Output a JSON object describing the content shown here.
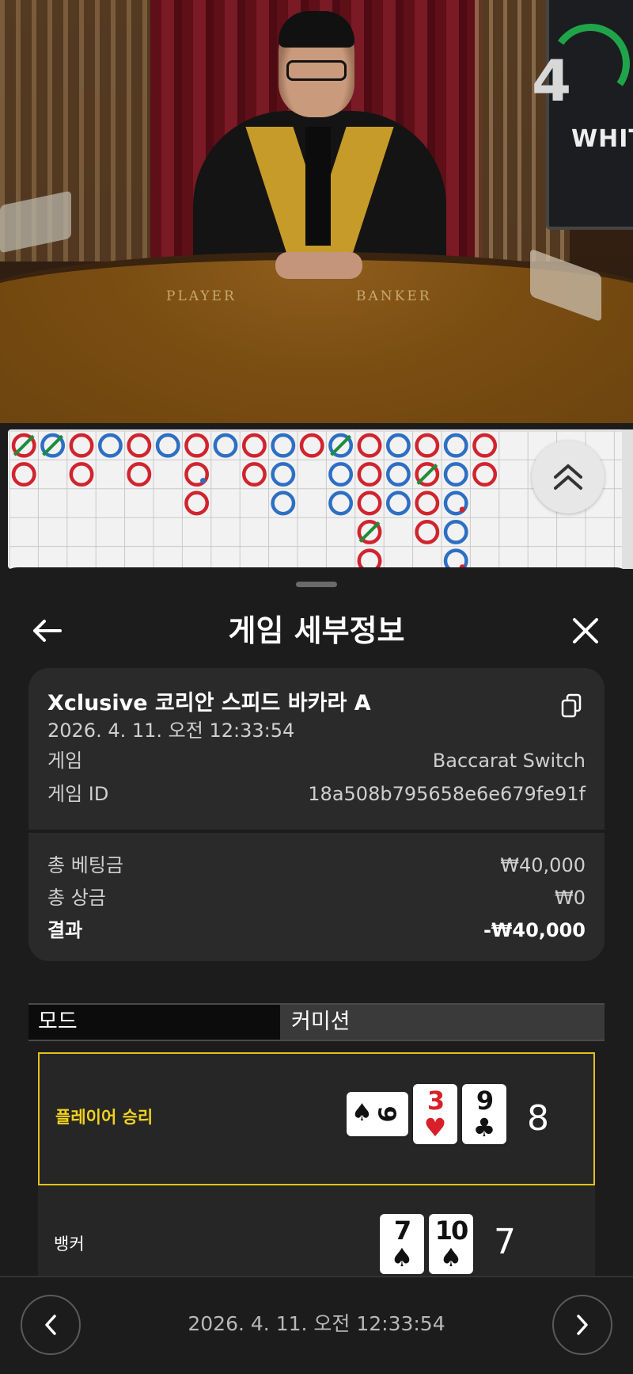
{
  "video": {
    "timer_value": "4",
    "brand_text": "WHITE",
    "table_label_player": "PLAYER",
    "table_label_banker": "BANKER"
  },
  "roadmap": {
    "colors": {
      "banker": "#d0242e",
      "player": "#2e6fc4",
      "tie_slash": "#1e8c3a",
      "grid": "#c9c9c9",
      "background": "#f2f2f2"
    },
    "columns": [
      [
        "B*",
        "B"
      ],
      [
        "P*"
      ],
      [
        "B",
        "B"
      ],
      [
        "P"
      ],
      [
        "B",
        "B"
      ],
      [
        "P"
      ],
      [
        "B",
        "B.",
        "B"
      ],
      [
        "P"
      ],
      [
        "B",
        "B"
      ],
      [
        "P",
        "P",
        "P"
      ],
      [
        "B"
      ],
      [
        "P*",
        "P",
        "P"
      ],
      [
        "B",
        "B",
        "B",
        "B*",
        "B"
      ],
      [
        "P",
        "P",
        "P"
      ],
      [
        "B",
        "B*",
        "B",
        "B"
      ],
      [
        "P",
        "P",
        "P.",
        "P",
        "P."
      ],
      [
        "B",
        "B"
      ]
    ]
  },
  "sheet": {
    "title": "게임 세부정보",
    "table_name": "Xclusive 코리안 스피드 바카라 A",
    "game_time": "2026. 4. 11. 오전 12:33:54",
    "game_label": "게임",
    "game_value": "Baccarat Switch",
    "game_id_label": "게임 ID",
    "game_id_value": "18a508b795658e6e679fe91f",
    "total_bet_label": "총 베팅금",
    "total_bet_value": "₩40,000",
    "total_win_label": "총 상금",
    "total_win_value": "₩0",
    "result_label": "결과",
    "result_value": "-₩40,000",
    "mode_label": "모드",
    "mode_value": "커미션",
    "accent_color": "#e0c21a"
  },
  "hands": {
    "player": {
      "label": "플레이어 승리",
      "score": "8",
      "cards": [
        {
          "rank": "9",
          "suit": "♠",
          "color": "black",
          "orientation": "sideways"
        },
        {
          "rank": "3",
          "suit": "♥",
          "color": "red",
          "orientation": "upright"
        },
        {
          "rank": "9",
          "suit": "♣",
          "color": "black",
          "orientation": "upright"
        }
      ]
    },
    "banker": {
      "label": "뱅커",
      "score": "7",
      "cards": [
        {
          "rank": "7",
          "suit": "♠",
          "color": "black",
          "orientation": "upright"
        },
        {
          "rank": "10",
          "suit": "♠",
          "color": "black",
          "orientation": "upright"
        }
      ]
    }
  },
  "footer": {
    "nav_time": "2026. 4. 11. 오전 12:33:54"
  },
  "icons": {
    "back": "arrow-left-icon",
    "close": "close-icon",
    "copy": "copy-icon",
    "expand": "chevron-double-up-icon",
    "prev": "chevron-left-icon",
    "next": "chevron-right-icon"
  }
}
